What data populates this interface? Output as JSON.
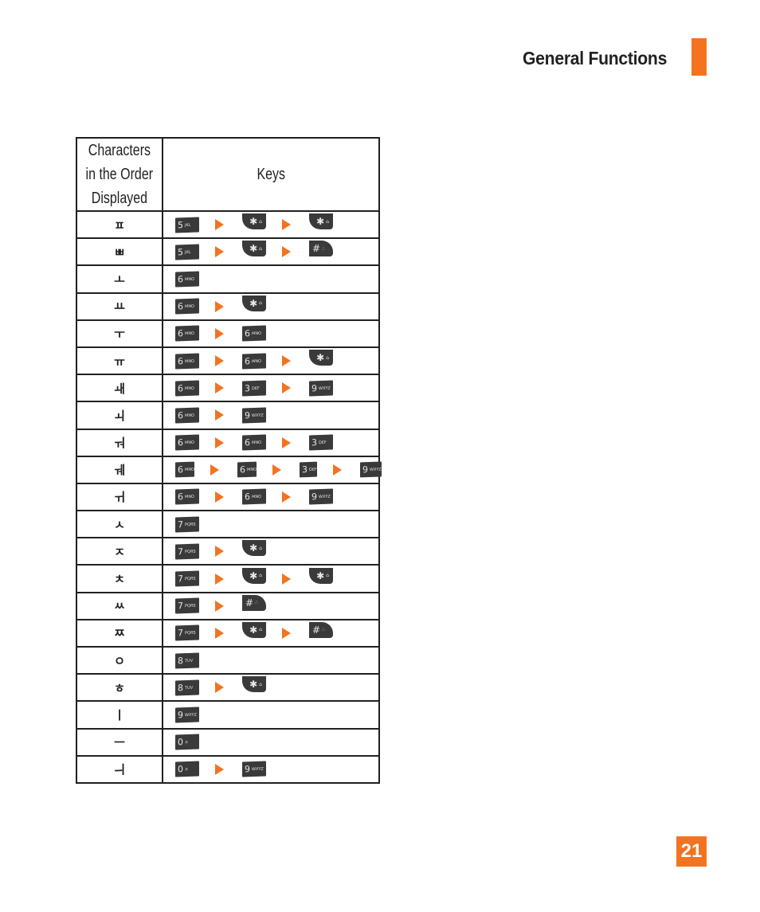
{
  "header": {
    "title": "General Functions",
    "accent_color": "#f37321"
  },
  "table": {
    "col_headers": {
      "characters_line1": "Characters",
      "characters_line2": "in the Order",
      "characters_line3": "Displayed",
      "keys": "Keys"
    },
    "rows": [
      {
        "char": "ㅍ",
        "keys": [
          {
            "type": "num",
            "digit": "5",
            "letters": "JKL"
          },
          {
            "type": "star"
          },
          {
            "type": "star"
          }
        ]
      },
      {
        "char": "ㅃ",
        "keys": [
          {
            "type": "num",
            "digit": "5",
            "letters": "JKL"
          },
          {
            "type": "star"
          },
          {
            "type": "hash"
          }
        ]
      },
      {
        "char": "ㅗ",
        "keys": [
          {
            "type": "num",
            "digit": "6",
            "letters": "MNO"
          }
        ]
      },
      {
        "char": "ㅛ",
        "keys": [
          {
            "type": "num",
            "digit": "6",
            "letters": "MNO"
          },
          {
            "type": "star"
          }
        ]
      },
      {
        "char": "ㅜ",
        "keys": [
          {
            "type": "num",
            "digit": "6",
            "letters": "MNO"
          },
          {
            "type": "num",
            "digit": "6",
            "letters": "MNO"
          }
        ]
      },
      {
        "char": "ㅠ",
        "keys": [
          {
            "type": "num",
            "digit": "6",
            "letters": "MNO"
          },
          {
            "type": "num",
            "digit": "6",
            "letters": "MNO"
          },
          {
            "type": "star"
          }
        ]
      },
      {
        "char": "ㅙ",
        "keys": [
          {
            "type": "num",
            "digit": "6",
            "letters": "MNO"
          },
          {
            "type": "num",
            "digit": "3",
            "letters": "DEF"
          },
          {
            "type": "num",
            "digit": "9",
            "letters": "WXYZ"
          }
        ]
      },
      {
        "char": "ㅚ",
        "keys": [
          {
            "type": "num",
            "digit": "6",
            "letters": "MNO"
          },
          {
            "type": "num",
            "digit": "9",
            "letters": "WXYZ"
          }
        ]
      },
      {
        "char": "ㅝ",
        "keys": [
          {
            "type": "num",
            "digit": "6",
            "letters": "MNO"
          },
          {
            "type": "num",
            "digit": "6",
            "letters": "MNO"
          },
          {
            "type": "num",
            "digit": "3",
            "letters": "DEF"
          }
        ]
      },
      {
        "char": "ㅞ",
        "keys": [
          {
            "type": "num",
            "digit": "6",
            "letters": "MNO"
          },
          {
            "type": "num",
            "digit": "6",
            "letters": "MNO"
          },
          {
            "type": "num",
            "digit": "3",
            "letters": "DEF"
          },
          {
            "type": "num",
            "digit": "9",
            "letters": "WXYZ"
          }
        ]
      },
      {
        "char": "ㅟ",
        "keys": [
          {
            "type": "num",
            "digit": "6",
            "letters": "MNO"
          },
          {
            "type": "num",
            "digit": "6",
            "letters": "MNO"
          },
          {
            "type": "num",
            "digit": "9",
            "letters": "WXYZ"
          }
        ]
      },
      {
        "char": "ㅅ",
        "keys": [
          {
            "type": "num",
            "digit": "7",
            "letters": "PQRS"
          }
        ]
      },
      {
        "char": "ㅈ",
        "keys": [
          {
            "type": "num",
            "digit": "7",
            "letters": "PQRS"
          },
          {
            "type": "star"
          }
        ]
      },
      {
        "char": "ㅊ",
        "keys": [
          {
            "type": "num",
            "digit": "7",
            "letters": "PQRS"
          },
          {
            "type": "star"
          },
          {
            "type": "star"
          }
        ]
      },
      {
        "char": "ㅆ",
        "keys": [
          {
            "type": "num",
            "digit": "7",
            "letters": "PQRS"
          },
          {
            "type": "hash"
          }
        ]
      },
      {
        "char": "ㅉ",
        "keys": [
          {
            "type": "num",
            "digit": "7",
            "letters": "PQRS"
          },
          {
            "type": "star"
          },
          {
            "type": "hash"
          }
        ]
      },
      {
        "char": "ㅇ",
        "keys": [
          {
            "type": "num",
            "digit": "8",
            "letters": "TUV"
          }
        ]
      },
      {
        "char": "ㅎ",
        "keys": [
          {
            "type": "num",
            "digit": "8",
            "letters": "TUV"
          },
          {
            "type": "star"
          }
        ]
      },
      {
        "char": "ㅣ",
        "keys": [
          {
            "type": "num",
            "digit": "9",
            "letters": "WXYZ"
          }
        ]
      },
      {
        "char": "ㅡ",
        "keys": [
          {
            "type": "num",
            "digit": "0",
            "letters": "±"
          }
        ]
      },
      {
        "char": "ㅢ",
        "keys": [
          {
            "type": "num",
            "digit": "0",
            "letters": "±"
          },
          {
            "type": "num",
            "digit": "9",
            "letters": "WXYZ"
          }
        ]
      }
    ],
    "key_symbols": {
      "star": "✱",
      "star_sub": "⌂",
      "hash": "#",
      "hash_sub": "∴"
    }
  },
  "page_number": "21"
}
